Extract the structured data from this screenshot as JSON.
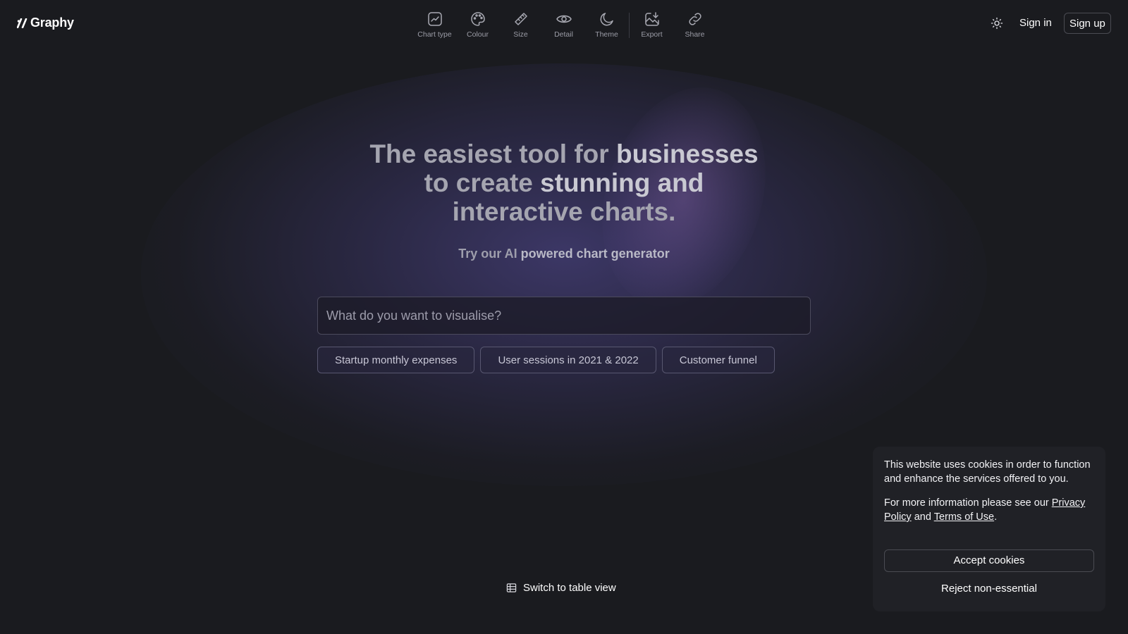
{
  "app": {
    "name": "Graphy"
  },
  "toolbar": {
    "items": [
      {
        "label": "Chart type",
        "icon": "chart-line-icon"
      },
      {
        "label": "Colour",
        "icon": "palette-icon"
      },
      {
        "label": "Size",
        "icon": "ruler-icon"
      },
      {
        "label": "Detail",
        "icon": "eye-icon"
      },
      {
        "label": "Theme",
        "icon": "moon-icon"
      },
      {
        "label": "Export",
        "icon": "image-download-icon"
      },
      {
        "label": "Share",
        "icon": "link-icon"
      }
    ]
  },
  "header": {
    "theme_toggle_icon": "sun-icon",
    "signin_label": "Sign in",
    "signup_label": "Sign up"
  },
  "hero": {
    "title_parts": [
      "The easiest tool for ",
      "businesses",
      "to create ",
      "stunning and",
      "interactive charts."
    ],
    "subtitle_dim": "Try our AI ",
    "subtitle_bright": "powered chart generator"
  },
  "search": {
    "value": "",
    "placeholder": "What do you want to visualise?"
  },
  "suggestions": [
    "Startup monthly expenses",
    "User sessions in 2021 & 2022",
    "Customer funnel"
  ],
  "table_switch": {
    "label": "Switch to table view",
    "icon": "table-icon"
  },
  "cookie": {
    "text1": "This website uses cookies in order to function and enhance the services offered to you.",
    "text2_prefix": "For more information please see our ",
    "privacy_link": "Privacy Policy",
    "and": " and ",
    "terms_link": "Terms of Use",
    "period": ".",
    "accept_label": "Accept cookies",
    "reject_label": "Reject non-essential"
  },
  "colors": {
    "background": "#1a1b1f",
    "card": "#202126",
    "glow": "#584ea0",
    "toolbar_label": "#9b9ca6"
  }
}
